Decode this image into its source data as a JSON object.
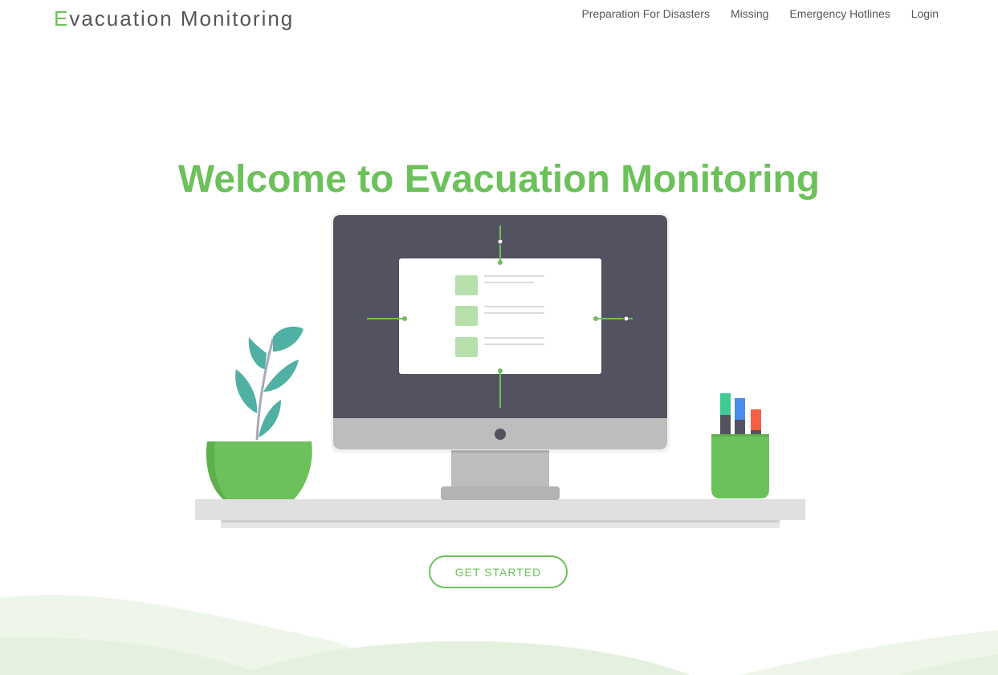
{
  "brand": {
    "first_letter": "E",
    "rest": "vacuation Monitoring"
  },
  "nav": {
    "items": [
      {
        "label": "Preparation For Disasters"
      },
      {
        "label": "Missing"
      },
      {
        "label": "Emergency Hotlines"
      },
      {
        "label": "Login"
      }
    ]
  },
  "hero": {
    "title": "Welcome to Evacuation Monitoring",
    "cta_label": "GET STARTED"
  },
  "colors": {
    "accent": "#6cc15a",
    "monitor_dark": "#53535f",
    "monitor_stand": "#bdbdbd",
    "leaf": "#4fb0a3",
    "wave_light": "#e8f3e3",
    "marker_teal": "#3ec995",
    "marker_blue": "#4a8cec",
    "marker_red": "#f55f44"
  },
  "icons": {
    "illustration": "desktop-computer-with-plant-and-pen-holder"
  }
}
